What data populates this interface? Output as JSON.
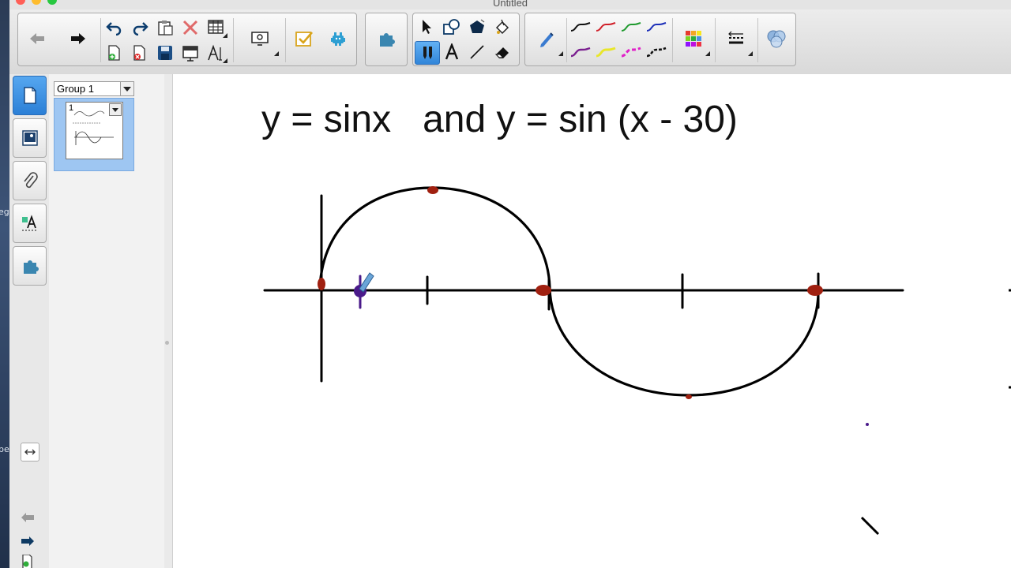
{
  "window": {
    "title": "Untitled"
  },
  "desktop": {
    "fragment_1": "eg",
    "fragment_2": "pe"
  },
  "toolbar": {
    "groups": [
      {
        "name": "navigation",
        "buttons": [
          "back-arrow-icon",
          "forward-arrow-icon",
          "undo-icon",
          "redo-icon",
          "paste-icon",
          "delete-icon",
          "table-icon",
          "add-page-icon",
          "delete-page-icon",
          "save-icon",
          "screen-shade-icon",
          "properties-icon",
          "display-icon",
          "response-icon",
          "addons-icon"
        ]
      },
      {
        "name": "extras",
        "buttons": [
          "puzzle-icon"
        ]
      },
      {
        "name": "tools",
        "buttons": [
          "select-icon",
          "shapes-icon",
          "polygon-icon",
          "fill-icon",
          "pen-tool-icon",
          "text-icon",
          "line-icon",
          "eraser-icon"
        ]
      },
      {
        "name": "pens",
        "buttons": [
          "pen-icon",
          "pen-black",
          "pen-red",
          "pen-green",
          "pen-blue",
          "pen-purple",
          "pen-yellow",
          "pen-magenta-dashed",
          "pen-black-dashed",
          "color-palette-icon",
          "line-style-icon",
          "fill-effects-icon"
        ]
      }
    ],
    "pen_colors": {
      "black": "#111111",
      "red": "#d0202a",
      "green": "#1f9a2e",
      "blue": "#1c2fb8",
      "purple": "#7a1f8f",
      "yellow": "#e8e62a",
      "magenta": "#e020c8",
      "black_dashed": "#111111"
    },
    "accent": "#4a9be8"
  },
  "sidebar": {
    "tabs": [
      "page-sorter-icon",
      "gallery-icon",
      "attachments-icon",
      "properties-icon",
      "addons-icon"
    ],
    "bottom": [
      "swap-side-icon",
      "back-arrow-icon",
      "forward-arrow-icon",
      "add-page-icon"
    ]
  },
  "sorter": {
    "group_label": "Group 1",
    "pages": [
      {
        "number": "1"
      }
    ]
  },
  "canvas": {
    "heading": "y = sinx   and y = sin (x - 30)",
    "ink_colors": {
      "curve": "#000000",
      "dots": "#a02010",
      "marker": "#4a1a8a"
    }
  }
}
